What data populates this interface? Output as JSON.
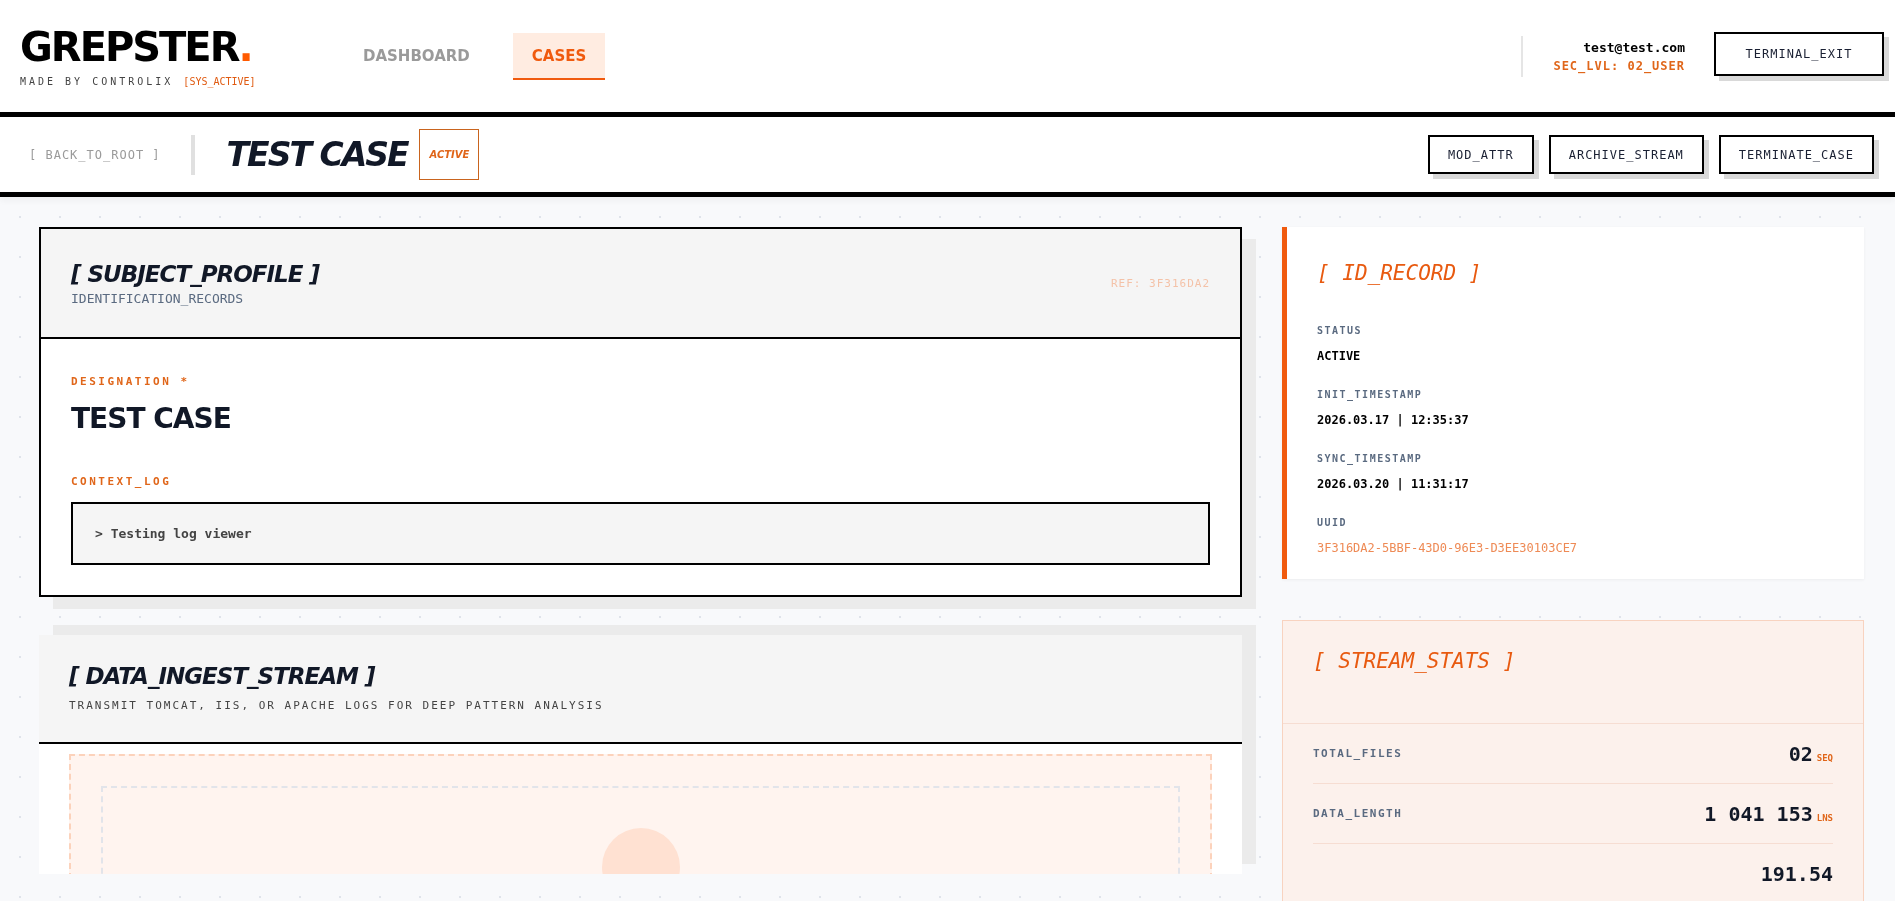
{
  "brand": {
    "name": "GREPSTER",
    "mark": ".",
    "tagline": "MADE BY CONTROLIX",
    "status_tag": "[SYS_ACTIVE]"
  },
  "nav": [
    {
      "label": "DASHBOARD",
      "selected": false
    },
    {
      "label": "CASES",
      "selected": true
    }
  ],
  "user": {
    "email": "test@test.com",
    "level": "SEC_LVL: 02_USER"
  },
  "exit_button": "TERMINAL_EXIT",
  "case_bar": {
    "back": "[ BACK_TO_ROOT ]",
    "title": "TEST CASE",
    "status": "ACTIVE",
    "actions": [
      "MOD_ATTR",
      "ARCHIVE_STREAM",
      "TERMINATE_CASE"
    ]
  },
  "profile": {
    "title": "[ SUBJECT_PROFILE ]",
    "subtitle": "IDENTIFICATION_RECORDS",
    "ref": "REF: 3F316DA2",
    "fields": [
      {
        "kind": "heading",
        "label": "DESIGNATION *",
        "value": "TEST CASE"
      },
      {
        "kind": "log",
        "label": "CONTEXT_LOG",
        "value": "> Testing log viewer"
      }
    ]
  },
  "ingest": {
    "title": "[ DATA_INGEST_STREAM ]",
    "subtitle": "TRANSMIT TOMCAT, IIS, OR APACHE LOGS FOR DEEP PATTERN ANALYSIS"
  },
  "id_record": {
    "title": "[ ID_RECORD ]",
    "fields": [
      {
        "kind": "text",
        "label": "STATUS",
        "value": "ACTIVE"
      },
      {
        "kind": "text",
        "label": "INIT_TIMESTAMP",
        "value": "2026.03.17 | 12:35:37"
      },
      {
        "kind": "text",
        "label": "SYNC_TIMESTAMP",
        "value": "2026.03.20 | 11:31:17"
      },
      {
        "kind": "uuid",
        "label": "UUID",
        "value": "3F316DA2-5BBF-43D0-96E3-D3EE30103CE7"
      }
    ]
  },
  "stream_stats": {
    "title": "[ STREAM_STATS ]",
    "rows": [
      {
        "label": "TOTAL_FILES",
        "value": "02",
        "unit": "SEQ"
      },
      {
        "label": "DATA_LENGTH",
        "value": "1 041 153",
        "unit": "LNS"
      },
      {
        "value": "191.54"
      }
    ]
  }
}
